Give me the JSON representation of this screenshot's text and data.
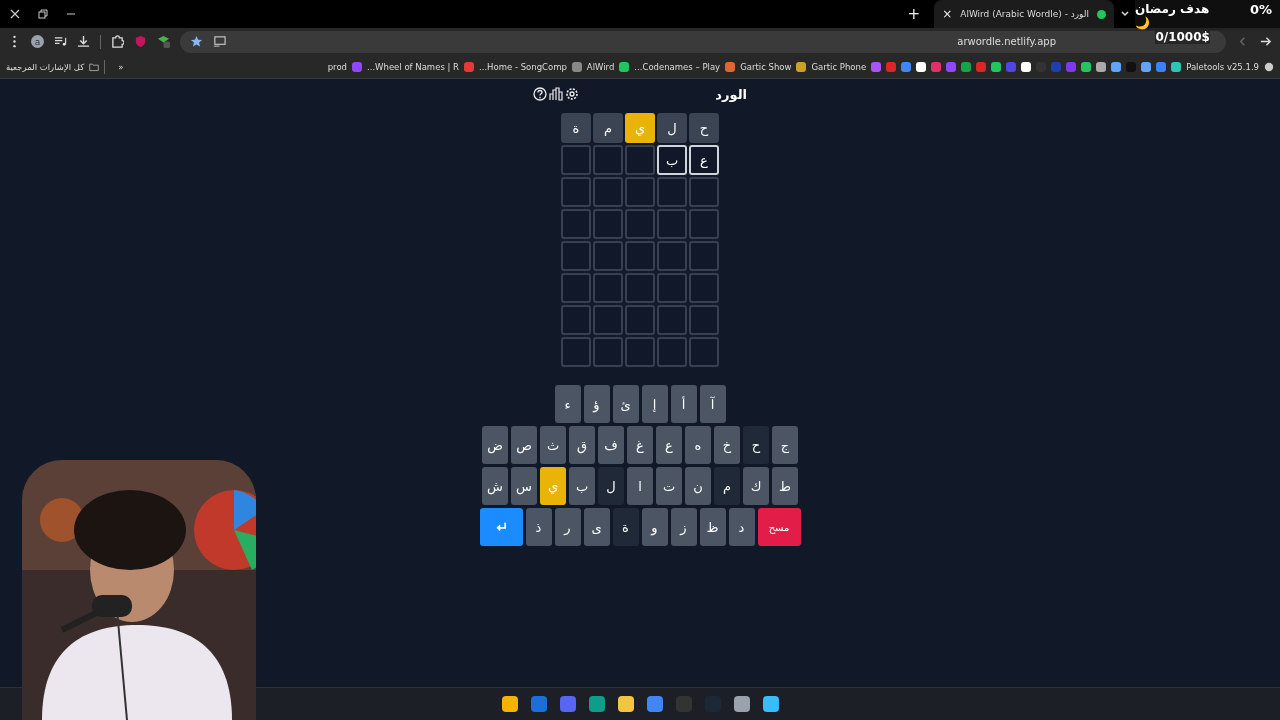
{
  "tab": {
    "title": "AlWird (Arabic Wordle) - الورد",
    "new_tab": "+",
    "close": "×"
  },
  "address_bar": {
    "url": "arwordle.netlify.app"
  },
  "profile": {
    "initial": "a"
  },
  "bookmarks": {
    "first": {
      "label": "Paletools v25.1.9"
    },
    "items": [
      {
        "label": "Gartic Phone",
        "color": "#a855f7"
      },
      {
        "label": "Gartic Show",
        "color": "#c9a227"
      },
      {
        "label": "Codenames – Play...",
        "color": "#e0662f"
      },
      {
        "label": "AlWird",
        "color": "#22c55e"
      },
      {
        "label": "Home - SongComp...",
        "color": "#888888"
      },
      {
        "label": "Wheel of Names | R...",
        "color": "#e53935"
      },
      {
        "label": "prod",
        "color": "#9146ff"
      }
    ],
    "more": "«",
    "all_label": "كل الإشارات المرجعية"
  },
  "overlay": {
    "goal": "هدف رمضان 🌙",
    "amount": "0/1000$",
    "percent": "0%"
  },
  "game": {
    "title": "الورد",
    "rows": [
      [
        {
          "letter": "ح",
          "kind": "absent"
        },
        {
          "letter": "ل",
          "kind": "absent"
        },
        {
          "letter": "ي",
          "kind": "present"
        },
        {
          "letter": "م",
          "kind": "absent"
        },
        {
          "letter": "ة",
          "kind": "absent"
        }
      ],
      [
        {
          "letter": "ع",
          "kind": "typed"
        },
        {
          "letter": "ب",
          "kind": "typed"
        },
        {
          "kind": "empty"
        },
        {
          "kind": "empty"
        },
        {
          "kind": "empty"
        }
      ],
      [
        {
          "kind": "empty"
        },
        {
          "kind": "empty"
        },
        {
          "kind": "empty"
        },
        {
          "kind": "empty"
        },
        {
          "kind": "empty"
        }
      ],
      [
        {
          "kind": "empty"
        },
        {
          "kind": "empty"
        },
        {
          "kind": "empty"
        },
        {
          "kind": "empty"
        },
        {
          "kind": "empty"
        }
      ],
      [
        {
          "kind": "empty"
        },
        {
          "kind": "empty"
        },
        {
          "kind": "empty"
        },
        {
          "kind": "empty"
        },
        {
          "kind": "empty"
        }
      ],
      [
        {
          "kind": "empty"
        },
        {
          "kind": "empty"
        },
        {
          "kind": "empty"
        },
        {
          "kind": "empty"
        },
        {
          "kind": "empty"
        }
      ],
      [
        {
          "kind": "empty"
        },
        {
          "kind": "empty"
        },
        {
          "kind": "empty"
        },
        {
          "kind": "empty"
        },
        {
          "kind": "empty"
        }
      ],
      [
        {
          "kind": "empty"
        },
        {
          "kind": "empty"
        },
        {
          "kind": "empty"
        },
        {
          "kind": "empty"
        },
        {
          "kind": "empty"
        }
      ]
    ],
    "keyboard": [
      [
        {
          "label": "آ",
          "color": "#4b5563"
        },
        {
          "label": "أ",
          "color": "#4b5563"
        },
        {
          "label": "إ",
          "color": "#4b5563"
        },
        {
          "label": "ئ",
          "color": "#4b5563"
        },
        {
          "label": "ؤ",
          "color": "#4b5563"
        },
        {
          "label": "ء",
          "color": "#4b5563"
        }
      ],
      [
        {
          "label": "ج",
          "color": "#4b5563"
        },
        {
          "label": "ح",
          "color": "#1f2937"
        },
        {
          "label": "خ",
          "color": "#4b5563"
        },
        {
          "label": "ه",
          "color": "#4b5563"
        },
        {
          "label": "ع",
          "color": "#4b5563"
        },
        {
          "label": "غ",
          "color": "#4b5563"
        },
        {
          "label": "ف",
          "color": "#4b5563"
        },
        {
          "label": "ق",
          "color": "#4b5563"
        },
        {
          "label": "ث",
          "color": "#4b5563"
        },
        {
          "label": "ص",
          "color": "#4b5563"
        },
        {
          "label": "ض",
          "color": "#4b5563"
        }
      ],
      [
        {
          "label": "ط",
          "color": "#4b5563"
        },
        {
          "label": "ك",
          "color": "#4b5563"
        },
        {
          "label": "م",
          "color": "#1f2937"
        },
        {
          "label": "ن",
          "color": "#4b5563"
        },
        {
          "label": "ت",
          "color": "#4b5563"
        },
        {
          "label": "ا",
          "color": "#4b5563"
        },
        {
          "label": "ل",
          "color": "#1f2937"
        },
        {
          "label": "ب",
          "color": "#4b5563"
        },
        {
          "label": "ي",
          "color": "#eab308"
        },
        {
          "label": "س",
          "color": "#4b5563"
        },
        {
          "label": "ش",
          "color": "#4b5563"
        }
      ],
      [
        {
          "kind": "delete",
          "label": "مسح"
        },
        {
          "kind": "letter",
          "label": "د",
          "color": "#4b5563"
        },
        {
          "kind": "letter",
          "label": "ظ",
          "color": "#4b5563"
        },
        {
          "kind": "letter",
          "label": "ز",
          "color": "#4b5563"
        },
        {
          "kind": "letter",
          "label": "و",
          "color": "#4b5563"
        },
        {
          "kind": "letter",
          "label": "ة",
          "color": "#1f2937"
        },
        {
          "kind": "letter",
          "label": "ى",
          "color": "#4b5563"
        },
        {
          "kind": "letter",
          "label": "ر",
          "color": "#4b5563"
        },
        {
          "kind": "letter",
          "label": "ذ",
          "color": "#4b5563"
        },
        {
          "kind": "enter"
        }
      ]
    ]
  }
}
